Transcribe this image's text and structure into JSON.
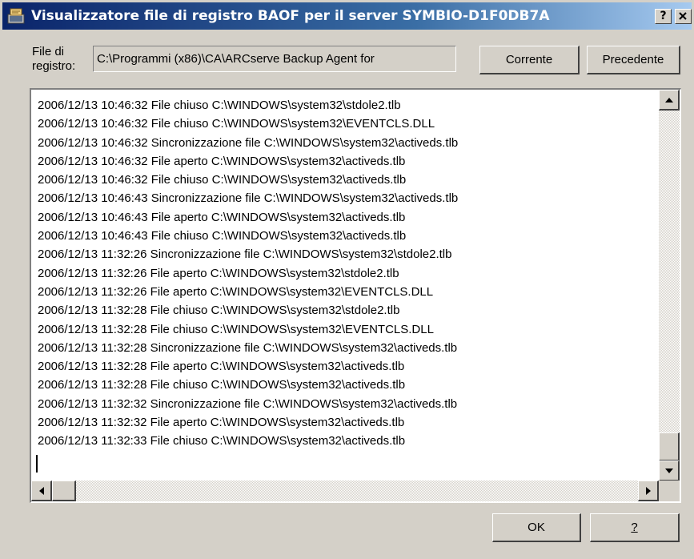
{
  "window": {
    "title": "Visualizzatore file di registro BAOF per il server SYMBIO-D1F0DB7A",
    "help_glyph": "?",
    "close_glyph": "✕"
  },
  "file_row": {
    "label_line1": "File di",
    "label_line2": "registro:",
    "value": "C:\\Programmi (x86)\\CA\\ARCserve Backup Agent for",
    "corrente_label": "Corrente",
    "precedente_label": "Precedente"
  },
  "log": {
    "lines": [
      "2006/12/13 10:46:32 File chiuso C:\\WINDOWS\\system32\\stdole2.tlb",
      "2006/12/13 10:46:32 File chiuso C:\\WINDOWS\\system32\\EVENTCLS.DLL",
      "2006/12/13 10:46:32 Sincronizzazione file C:\\WINDOWS\\system32\\activeds.tlb",
      "2006/12/13 10:46:32 File aperto C:\\WINDOWS\\system32\\activeds.tlb",
      "2006/12/13 10:46:32 File chiuso C:\\WINDOWS\\system32\\activeds.tlb",
      "2006/12/13 10:46:43 Sincronizzazione file C:\\WINDOWS\\system32\\activeds.tlb",
      "2006/12/13 10:46:43 File aperto C:\\WINDOWS\\system32\\activeds.tlb",
      "2006/12/13 10:46:43 File chiuso C:\\WINDOWS\\system32\\activeds.tlb",
      "2006/12/13 11:32:26 Sincronizzazione file C:\\WINDOWS\\system32\\stdole2.tlb",
      "2006/12/13 11:32:26 File aperto C:\\WINDOWS\\system32\\stdole2.tlb",
      "2006/12/13 11:32:26 File aperto C:\\WINDOWS\\system32\\EVENTCLS.DLL",
      "2006/12/13 11:32:28 File chiuso C:\\WINDOWS\\system32\\stdole2.tlb",
      "2006/12/13 11:32:28 File chiuso C:\\WINDOWS\\system32\\EVENTCLS.DLL",
      "2006/12/13 11:32:28 Sincronizzazione file C:\\WINDOWS\\system32\\activeds.tlb",
      "2006/12/13 11:32:28 File aperto C:\\WINDOWS\\system32\\activeds.tlb",
      "2006/12/13 11:32:28 File chiuso C:\\WINDOWS\\system32\\activeds.tlb",
      "2006/12/13 11:32:32 Sincronizzazione file C:\\WINDOWS\\system32\\activeds.tlb",
      "2006/12/13 11:32:32 File aperto C:\\WINDOWS\\system32\\activeds.tlb",
      "2006/12/13 11:32:33 File chiuso C:\\WINDOWS\\system32\\activeds.tlb"
    ]
  },
  "footer": {
    "ok_label": "OK",
    "help_label": "?"
  },
  "colors": {
    "titlebar_start": "#0a246a",
    "titlebar_end": "#a6caf0",
    "face": "#d4d0c8"
  },
  "icons": {
    "title_icon": "log-viewer-icon"
  }
}
